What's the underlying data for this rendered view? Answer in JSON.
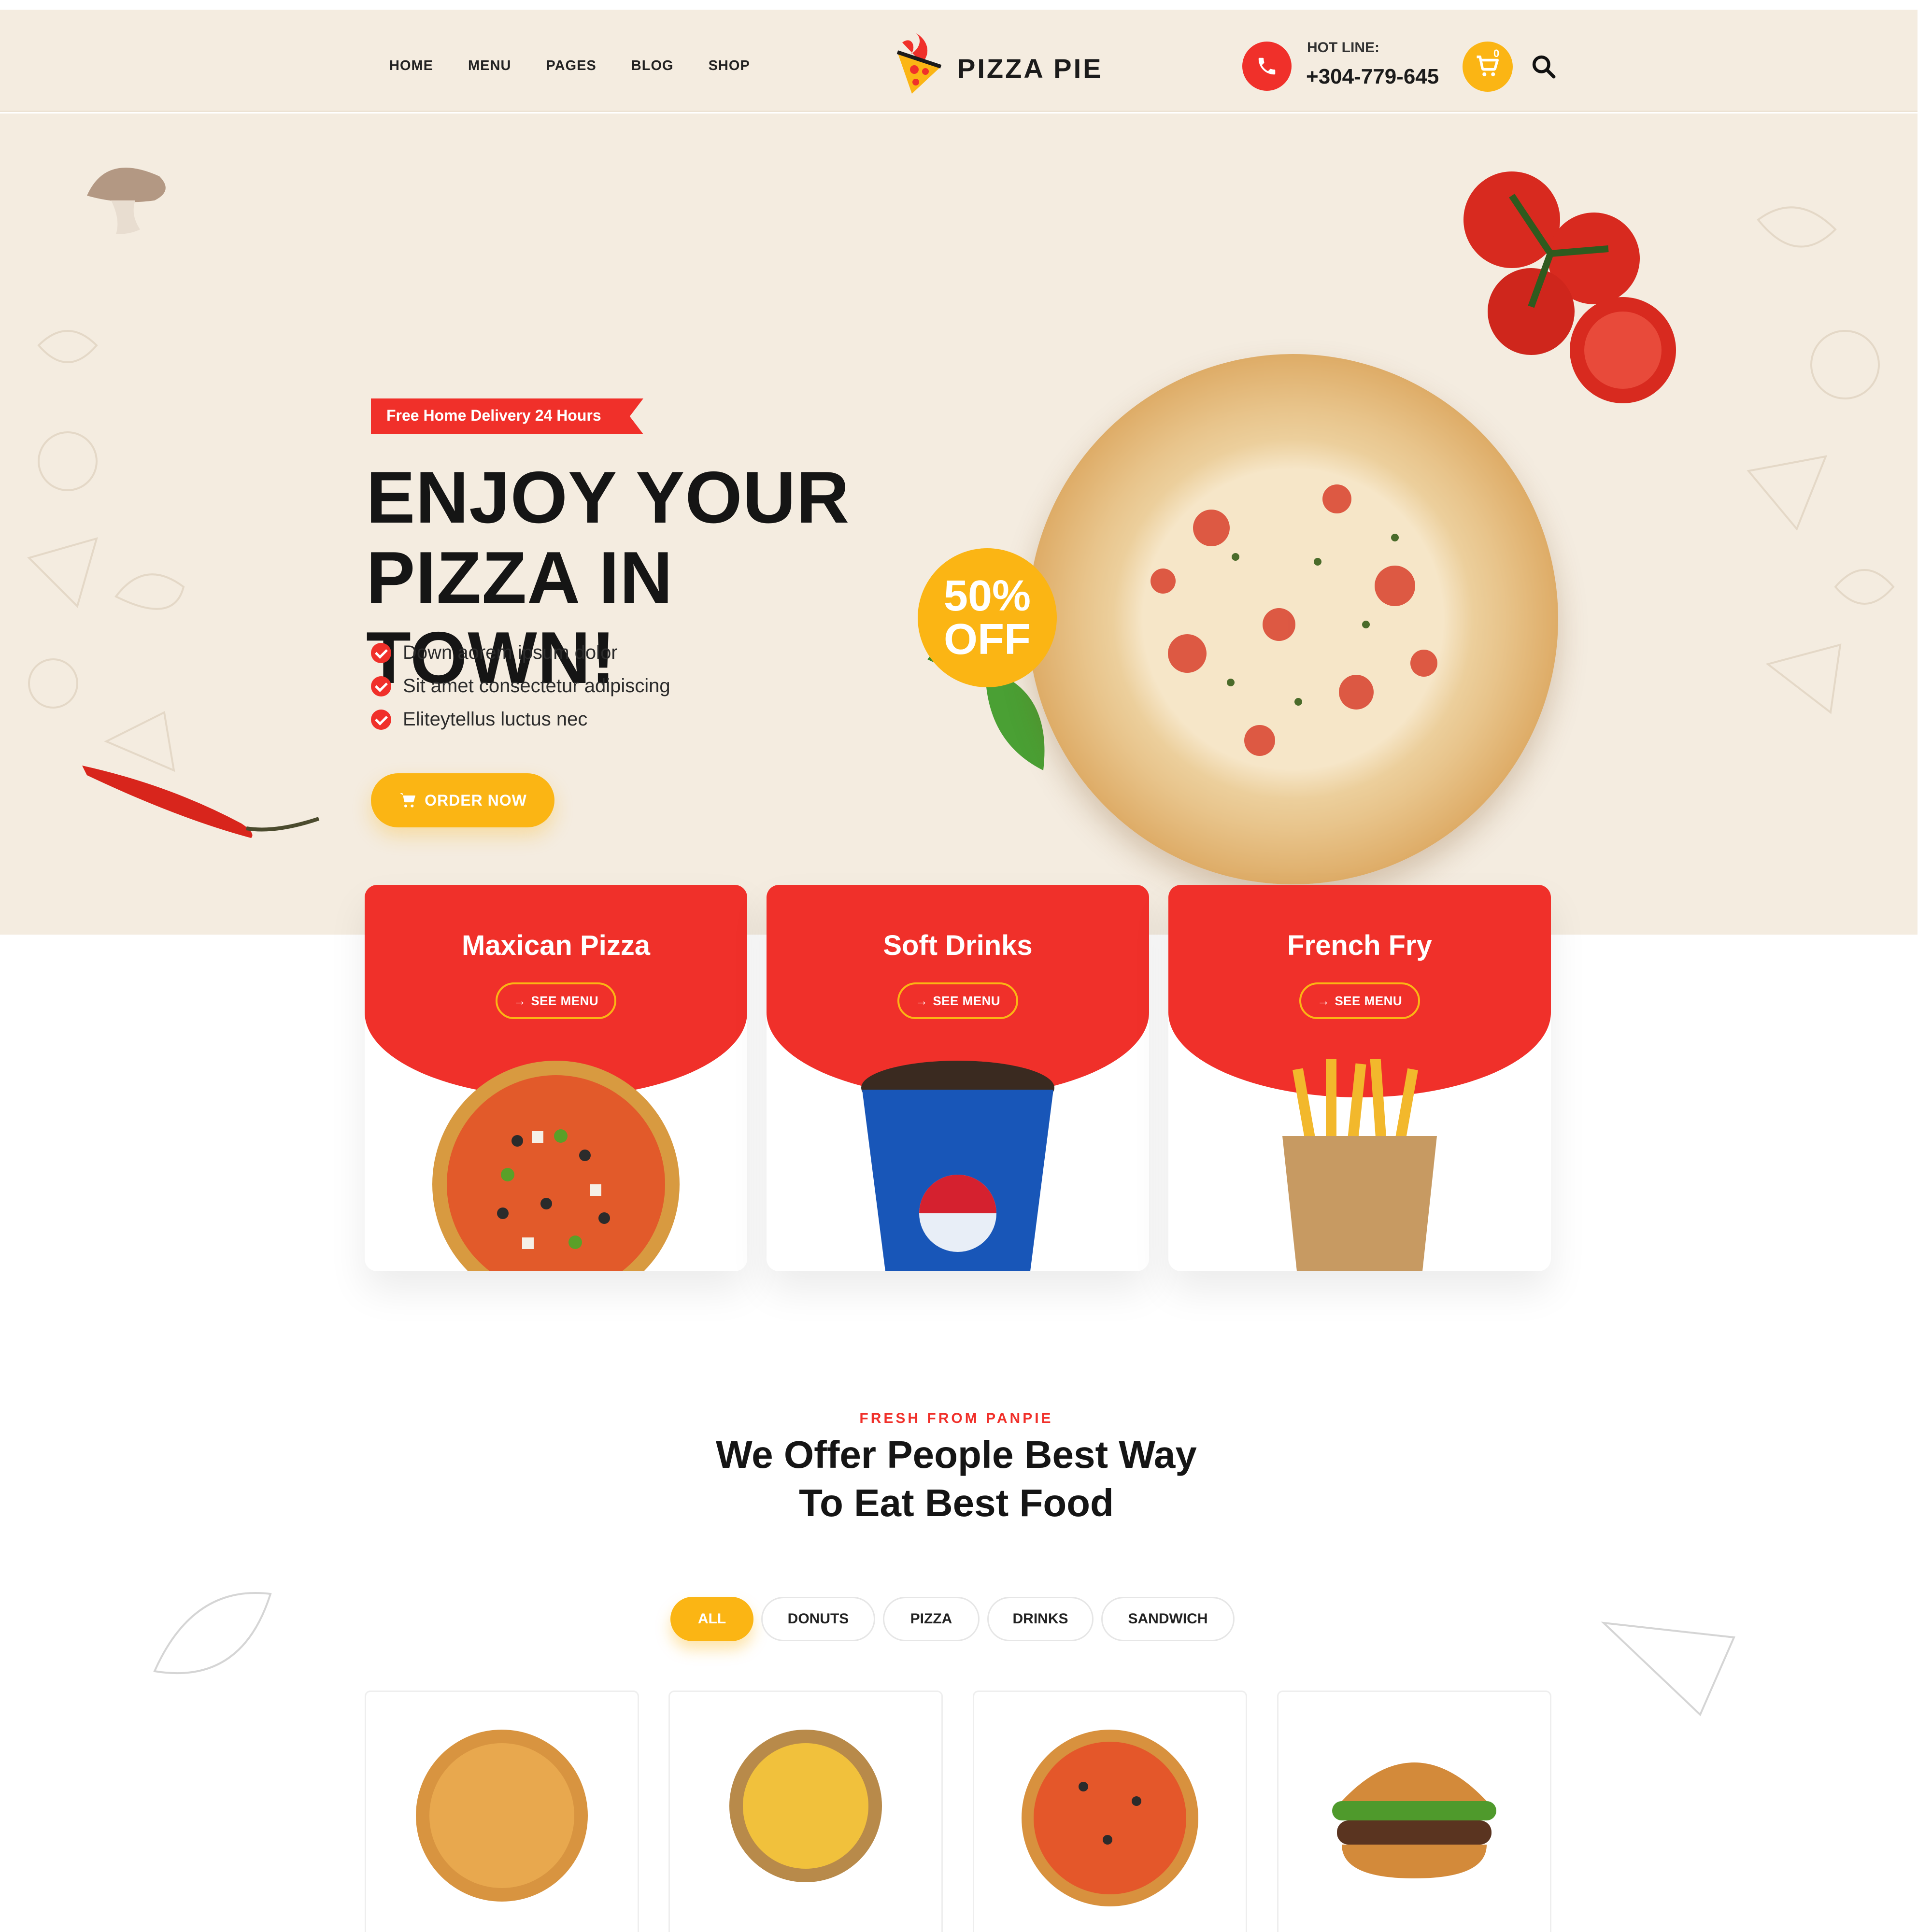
{
  "header": {
    "nav": [
      "HOME",
      "MENU",
      "PAGES",
      "BLOG",
      "SHOP"
    ],
    "logo_text": "PIZZA PIE",
    "hotline_label": "HOT LINE:",
    "hotline_number": "+304-779-645",
    "cart_count": "0"
  },
  "hero": {
    "badge": "Free Home Delivery 24 Hours",
    "title_line1": "ENJOY YOUR",
    "title_line2": "PIZZA IN TOWN!",
    "features": [
      "Down aorem ipsum dolor",
      "Sit amet consectetur adipiscing",
      "Eliteytellus luctus nec"
    ],
    "order_button": "ORDER NOW",
    "discount_line1": "50%",
    "discount_line2": "OFF"
  },
  "categories": [
    {
      "title": "Maxican Pizza",
      "button": "SEE MENU"
    },
    {
      "title": "Soft Drinks",
      "button": "SEE MENU"
    },
    {
      "title": "French Fry",
      "button": "SEE MENU"
    }
  ],
  "offer_section": {
    "eyebrow": "FRESH FROM PANPIE",
    "title_line1": "We Offer People Best Way",
    "title_line2": "To Eat Best Food",
    "tabs": [
      "ALL",
      "DONUTS",
      "PIZZA",
      "DRINKS",
      "SANDWICH"
    ],
    "active_tab": "ALL"
  },
  "colors": {
    "accent_red": "#f0302a",
    "accent_yellow": "#fbb514",
    "hero_bg": "#f4ece0"
  }
}
